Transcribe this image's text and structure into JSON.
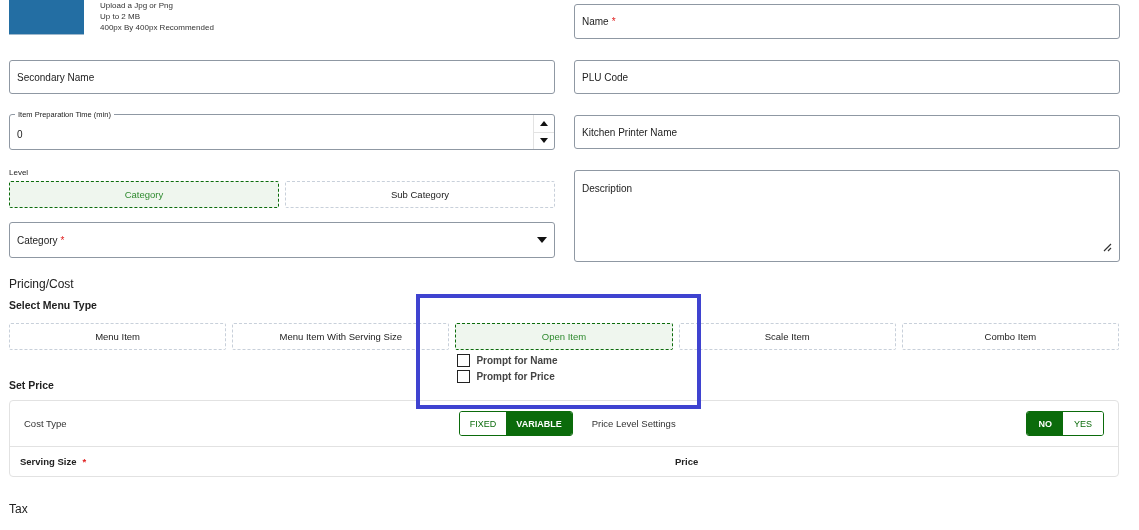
{
  "upload": {
    "hints": [
      "Upload a Jpg or Png",
      "Up to 2 MB",
      "400px By 400px Recommended"
    ]
  },
  "left_fields": [
    {
      "kind": "text",
      "label": "Secondary Name"
    },
    {
      "kind": "number",
      "label": "Item Preparation Time (min)",
      "value": "0"
    }
  ],
  "level": {
    "label": "Level",
    "options": [
      {
        "label": "Category",
        "selected": true
      },
      {
        "label": "Sub Category",
        "selected": false
      }
    ]
  },
  "category": {
    "kind": "select",
    "label": "Category",
    "required_mark": "*"
  },
  "right_fields": [
    {
      "kind": "text",
      "label": "Name",
      "required_mark": "*"
    },
    {
      "kind": "text",
      "label": "PLU Code"
    },
    {
      "kind": "text",
      "label": "Kitchen Printer Name"
    },
    {
      "kind": "textarea",
      "label": "Description"
    }
  ],
  "pricing": {
    "title": "Pricing/Cost",
    "menu_type_label": "Select Menu Type",
    "menu_types": [
      {
        "label": "Menu Item",
        "selected": false
      },
      {
        "label": "Menu Item With Serving Size",
        "selected": false
      },
      {
        "label": "Open Item",
        "selected": true,
        "prompts": [
          {
            "label": "Prompt for Name",
            "checked": false
          },
          {
            "label": "Prompt for Price",
            "checked": false
          }
        ]
      },
      {
        "label": "Scale Item",
        "selected": false
      },
      {
        "label": "Combo Item",
        "selected": false
      }
    ]
  },
  "set_price": {
    "title": "Set Price",
    "cost_type": {
      "label": "Cost Type",
      "options": [
        {
          "label": "FIXED",
          "selected": false
        },
        {
          "label": "VARIABLE",
          "selected": true
        }
      ]
    },
    "price_level": {
      "label": "Price Level Settings",
      "options": [
        {
          "label": "NO",
          "selected": true
        },
        {
          "label": "YES",
          "selected": false
        }
      ]
    },
    "columns": [
      {
        "label": "Serving Size",
        "required_mark": "*"
      },
      {
        "label": "Price"
      }
    ]
  },
  "tax": {
    "title": "Tax"
  }
}
